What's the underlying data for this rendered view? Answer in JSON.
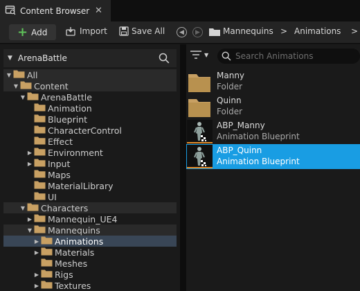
{
  "tab": {
    "title": "Content Browser",
    "close": "✕"
  },
  "toolbar": {
    "add_label": "Add",
    "import_label": "Import",
    "save_all_label": "Save All",
    "breadcrumb": [
      "Mannequins",
      "Animations"
    ],
    "crumb_sep": ">"
  },
  "left": {
    "header_title": "ArenaBattle",
    "tree": [
      {
        "label": "All",
        "depth": 0,
        "arrow": "▼",
        "open": true,
        "hl": true
      },
      {
        "label": "Content",
        "depth": 1,
        "arrow": "▼",
        "open": true,
        "hl": true
      },
      {
        "label": "ArenaBattle",
        "depth": 2,
        "arrow": "▼",
        "open": true
      },
      {
        "label": "Animation",
        "depth": 3,
        "arrow": ""
      },
      {
        "label": "Blueprint",
        "depth": 3,
        "arrow": ""
      },
      {
        "label": "CharacterControl",
        "depth": 3,
        "arrow": ""
      },
      {
        "label": "Effect",
        "depth": 3,
        "arrow": ""
      },
      {
        "label": "Environment",
        "depth": 3,
        "arrow": "▶"
      },
      {
        "label": "Input",
        "depth": 3,
        "arrow": "▶"
      },
      {
        "label": "Maps",
        "depth": 3,
        "arrow": ""
      },
      {
        "label": "MaterialLibrary",
        "depth": 3,
        "arrow": ""
      },
      {
        "label": "UI",
        "depth": 3,
        "arrow": ""
      },
      {
        "label": "Characters",
        "depth": 2,
        "arrow": "▼",
        "open": true,
        "hl": true
      },
      {
        "label": "Mannequin_UE4",
        "depth": 3,
        "arrow": "▶"
      },
      {
        "label": "Mannequins",
        "depth": 3,
        "arrow": "▼",
        "open": true,
        "hl": true
      },
      {
        "label": "Animations",
        "depth": 4,
        "arrow": "▶",
        "sel": true
      },
      {
        "label": "Materials",
        "depth": 4,
        "arrow": "▶"
      },
      {
        "label": "Meshes",
        "depth": 4,
        "arrow": ""
      },
      {
        "label": "Rigs",
        "depth": 4,
        "arrow": "▶"
      },
      {
        "label": "Textures",
        "depth": 4,
        "arrow": "▶"
      }
    ]
  },
  "right": {
    "search_placeholder": "Search Animations",
    "assets": [
      {
        "name": "Manny",
        "type": "Folder",
        "kind": "folder"
      },
      {
        "name": "Quinn",
        "type": "Folder",
        "kind": "folder"
      },
      {
        "name": "ABP_Manny",
        "type": "Animation Blueprint",
        "kind": "anim"
      },
      {
        "name": "ABP_Quinn",
        "type": "Animation Blueprint",
        "kind": "anim",
        "selected": true
      }
    ]
  },
  "colors": {
    "folder": "#c8a063",
    "selection_row": "#394656",
    "selection_asset": "#199de3",
    "add_plus": "#5fc35a"
  }
}
